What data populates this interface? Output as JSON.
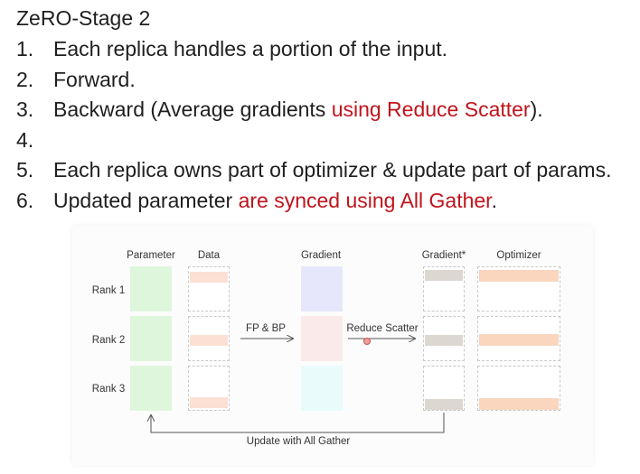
{
  "title": "ZeRO-Stage 2",
  "steps": [
    {
      "num": "1.",
      "text": "Each replica handles a portion of the input.",
      "highlight": ""
    },
    {
      "num": "2.",
      "text": "Forward.",
      "highlight": ""
    },
    {
      "num": "3.",
      "text": "Backward (Average gradients ",
      "highlight": "using Reduce Scatter",
      "suffix": ")."
    },
    {
      "num": "4.",
      "text": "",
      "highlight": ""
    },
    {
      "num": "5.",
      "text": "Each replica owns part of optimizer & update part of params.",
      "highlight": ""
    },
    {
      "num": "6.",
      "text": "Updated parameter ",
      "highlight": "are synced using All Gather",
      "suffix": "."
    }
  ],
  "colors": {
    "highlight": "#c0141c",
    "parameter": "#def7dc",
    "data_band": "#fbe0d3",
    "gradient_r1": "#e7e7fb",
    "gradient_r2": "#fbeaea",
    "gradient_r3": "#e9fbfb",
    "gradient_star_band": "#dcd7d1",
    "optimizer_band": "#f9d6bd"
  },
  "diagram": {
    "columns": {
      "parameter": "Parameter",
      "data": "Data",
      "gradient": "Gradient",
      "gradient_star": "Gradient*",
      "optimizer": "Optimizer"
    },
    "ranks": [
      "Rank 1",
      "Rank 2",
      "Rank 3"
    ],
    "arrows": {
      "fp_bp": "FP & BP",
      "reduce_scatter": "Reduce Scatter",
      "all_gather": "Update with All Gather"
    }
  }
}
